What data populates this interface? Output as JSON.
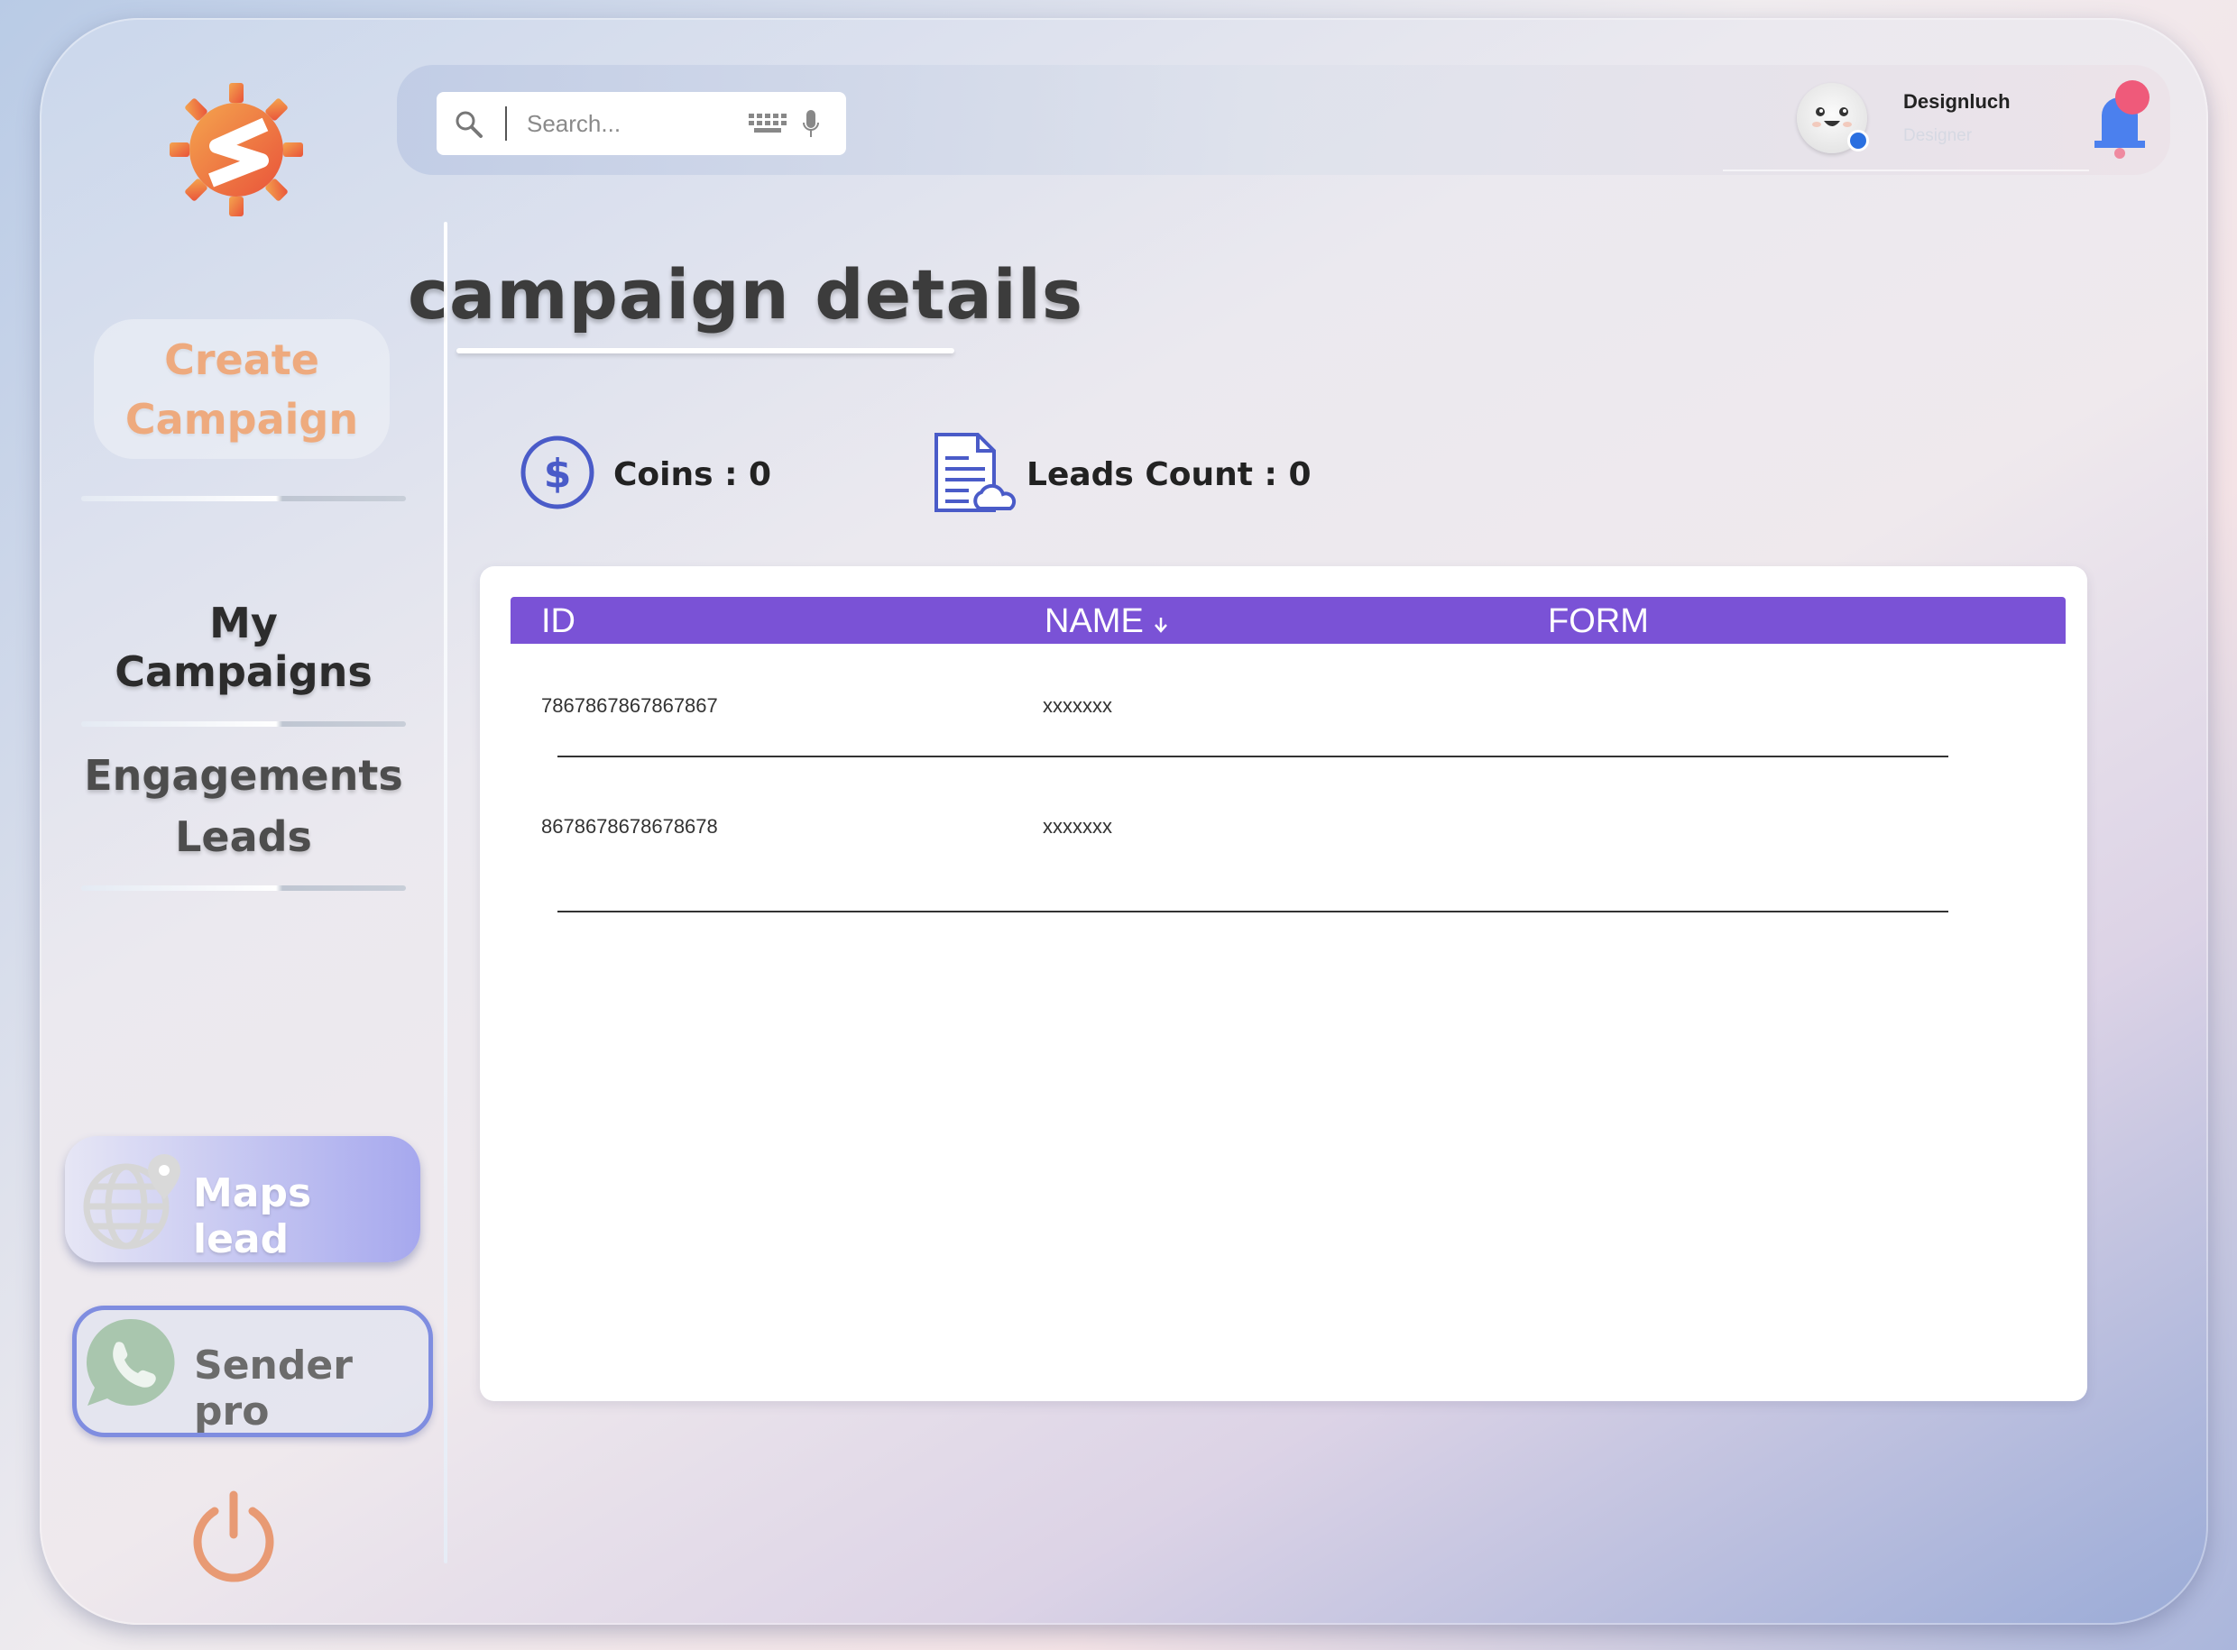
{
  "sidebar": {
    "create_campaign": "Create Campaign",
    "my_campaigns": "My Campaigns",
    "engagements_leads": "Engagements Leads",
    "maps_lead": "Maps lead",
    "sender_pro": "Sender pro"
  },
  "topbar": {
    "search_placeholder": "Search...",
    "user_name": "Designluch",
    "user_role": "Designer"
  },
  "main": {
    "title": "campaign details",
    "coins": "Coins : 0",
    "leads_count": "Leads Count : 0"
  },
  "table": {
    "columns": [
      "ID",
      "NAME",
      "FORM"
    ],
    "rows": [
      {
        "id": "7867867867867867",
        "name": "xxxxxxx",
        "form": ""
      },
      {
        "id": "8678678678678678",
        "name": "xxxxxxx",
        "form": ""
      }
    ]
  },
  "colors": {
    "accent_purple": "#7a52d6",
    "create_orange": "#f0a06a",
    "icon_blue": "#4a5bc8",
    "online_dot": "#2a6fe0",
    "bell_blue": "#4b80ee",
    "bell_badge": "#ef5a7a"
  },
  "icons": [
    "logo-gear-icon",
    "search-icon",
    "keyboard-icon",
    "mic-icon",
    "bell-icon",
    "coin-icon",
    "document-cloud-icon",
    "globe-pin-icon",
    "whatsapp-icon",
    "power-icon"
  ]
}
